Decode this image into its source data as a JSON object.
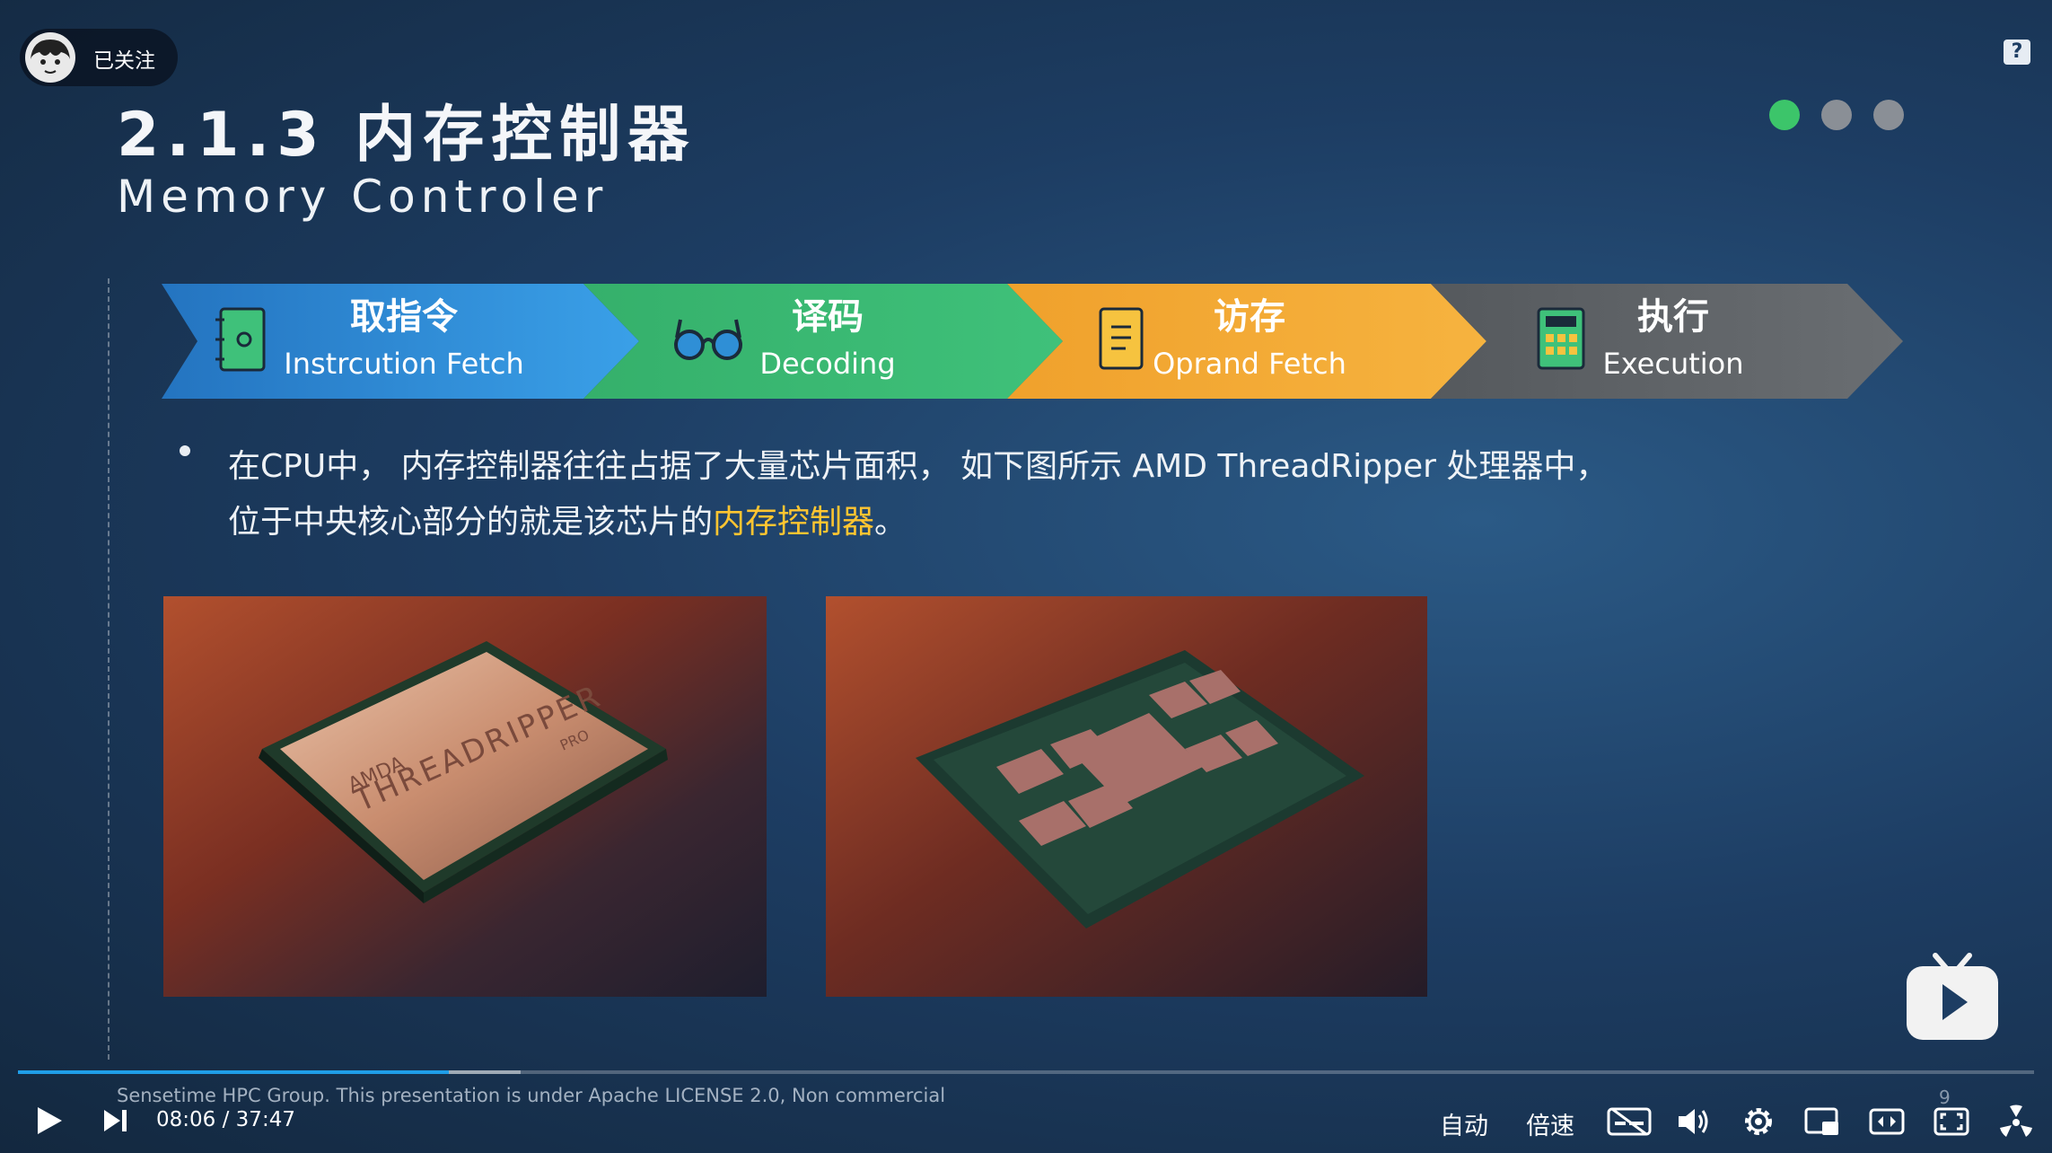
{
  "follow_badge": {
    "label": "已关注"
  },
  "slide": {
    "title_zh": "2.1.3  内存控制器",
    "title_en": "Memory Controler",
    "pipeline": [
      {
        "zh": "取指令",
        "en": "Instrcution Fetch",
        "color": "#2f8fd6",
        "icon": "notebook-icon"
      },
      {
        "zh": "译码",
        "en": "Decoding",
        "color": "#3cb372",
        "icon": "glasses-icon"
      },
      {
        "zh": "访存",
        "en": "Oprand Fetch",
        "color": "#f2a632",
        "icon": "document-icon"
      },
      {
        "zh": "执行",
        "en": "Execution",
        "color": "#5f6366",
        "icon": "calculator-icon"
      }
    ],
    "bullet": {
      "line1": "在CPU中， 内存控制器往往占据了大量芯片面积， 如下图所示 AMD ThreadRipper 处理器中，",
      "line2_prefix": "位于中央核心部分的就是该芯片的",
      "line2_highlight": "内存控制器",
      "line2_suffix": "。"
    },
    "photo1_text": {
      "brand": "AMDA",
      "name": "THREADRIPPER",
      "sub": "PRO"
    },
    "footer": "Sensetime HPC Group. This presentation is under Apache LICENSE 2.0, Non commercial",
    "page_number": "9"
  },
  "player": {
    "progress": 0.2138,
    "current_time": "08:06",
    "separator": "/",
    "total_time": "37:47",
    "auto_label": "自动",
    "speed_label": "倍速",
    "colors": {
      "progress": "#1f9ee8",
      "accent_dot": "#3cc56a"
    }
  }
}
